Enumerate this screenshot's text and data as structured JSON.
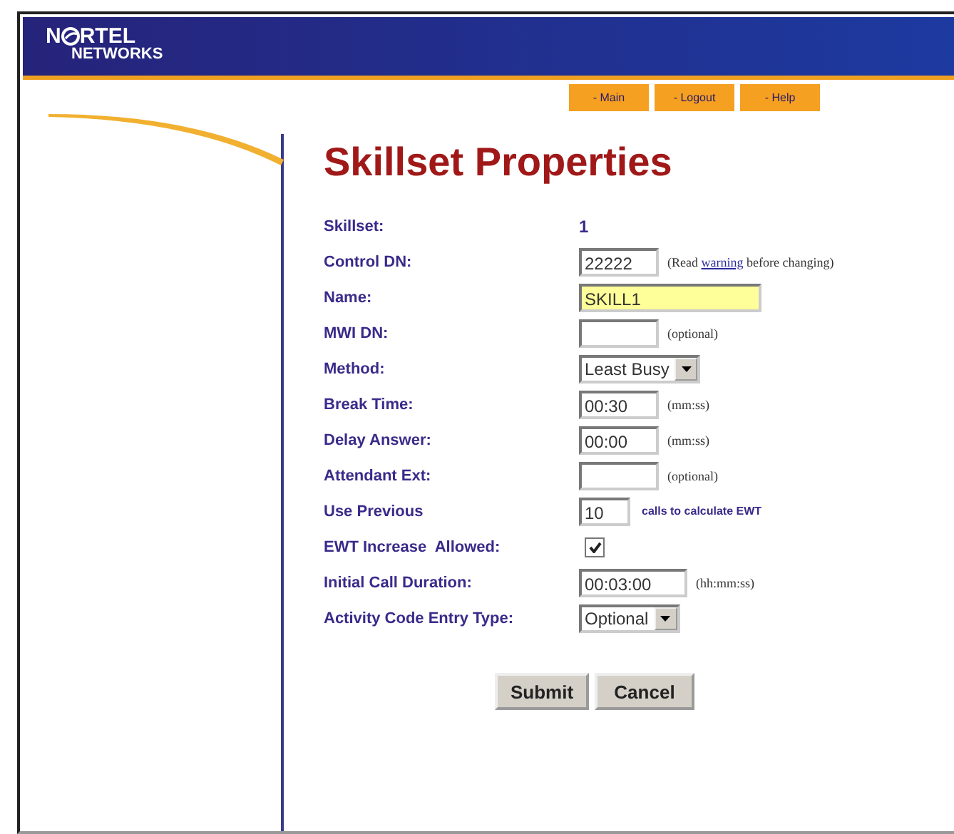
{
  "logo": {
    "prefix": "N",
    "suffix": "RTEL",
    "line2": "NETWORKS"
  },
  "nav": [
    "- Main",
    "- Logout",
    "- Help"
  ],
  "title": "Skillset Properties",
  "rows": [
    {
      "kind": "text",
      "label": "Skillset:",
      "value": "1"
    },
    {
      "kind": "input",
      "label": "Control DN:",
      "value": "22222",
      "hint_before": "(Read ",
      "link": "warning",
      "hint_after": " before changing)"
    },
    {
      "kind": "input",
      "label": "Name:",
      "value": "SKILL1",
      "highlight": true
    },
    {
      "kind": "input",
      "label": "MWI DN:",
      "hint_before": "(optional)"
    },
    {
      "kind": "select",
      "label": "Method:",
      "value": "Least Busy"
    },
    {
      "kind": "input",
      "label": "Break Time:",
      "value": "00:30",
      "hint_before": "(mm:ss)"
    },
    {
      "kind": "input",
      "label": "Delay Answer:",
      "value": "00:00",
      "hint_before": "(mm:ss)"
    },
    {
      "kind": "input",
      "label": "Attendant Ext:",
      "hint_before": "(optional)"
    },
    {
      "kind": "input",
      "label": "Use Previous",
      "value": "10",
      "note": "calls to calculate EWT"
    },
    {
      "kind": "checkbox",
      "label": "EWT Increase  Allowed:",
      "checked": true
    },
    {
      "kind": "input",
      "label": "Initial Call Duration:",
      "value": "00:03:00",
      "hint_before": "(hh:mm:ss)"
    },
    {
      "kind": "select",
      "label": "Activity Code Entry Type:",
      "value": "Optional"
    }
  ],
  "buttons": [
    "Submit",
    "Cancel"
  ]
}
